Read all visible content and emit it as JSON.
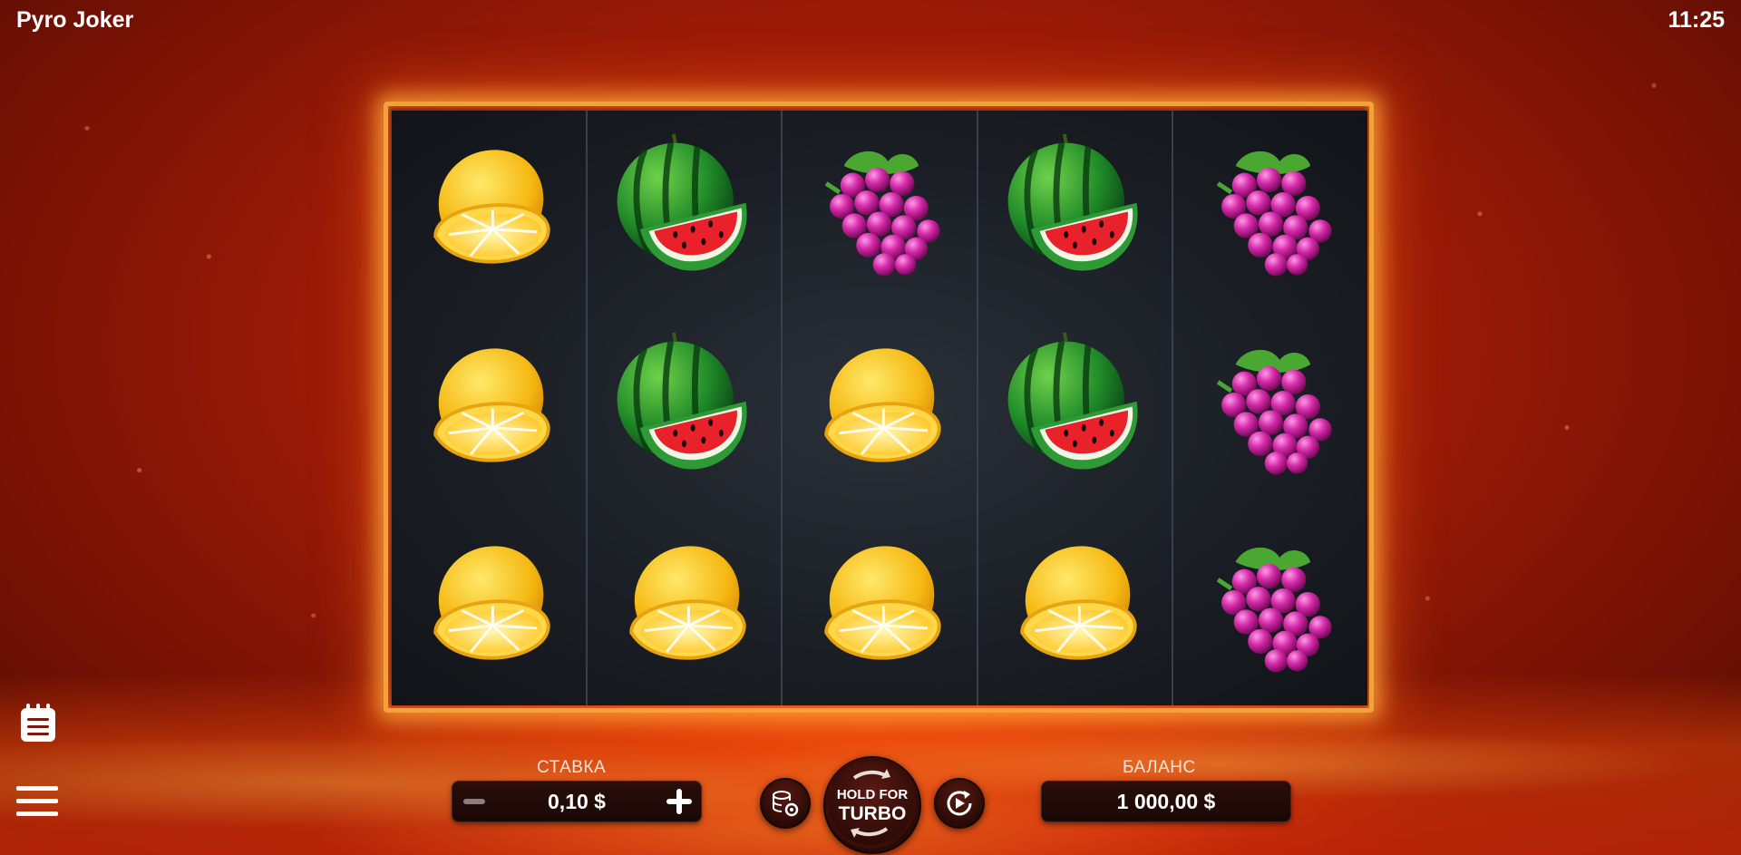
{
  "app": {
    "title": "Pyro Joker",
    "clock": "11:25"
  },
  "grid": {
    "reels": [
      [
        "lemon",
        "lemon",
        "lemon"
      ],
      [
        "watermelon",
        "watermelon",
        "lemon"
      ],
      [
        "grapes",
        "lemon",
        "lemon"
      ],
      [
        "watermelon",
        "watermelon",
        "lemon"
      ],
      [
        "grapes",
        "grapes",
        "grapes"
      ]
    ]
  },
  "controls": {
    "bet_label": "СТАВКА",
    "bet_value": "0,10 $",
    "balance_label": "БАЛАНС",
    "balance_value": "1 000,00 $",
    "spin_line1": "HOLD FOR",
    "spin_line2": "TURBO",
    "icons": {
      "paytable": "notepad-icon",
      "menu": "hamburger-menu-icon",
      "bet_settings": "coins-gear-icon",
      "autoplay": "autoplay-icon",
      "minus": "minus-icon",
      "plus": "plus-icon"
    }
  },
  "colors": {
    "frame_glow": "#f3a23a",
    "reel_bg": "#1a1e24",
    "panel_bg": "#1a0806"
  }
}
